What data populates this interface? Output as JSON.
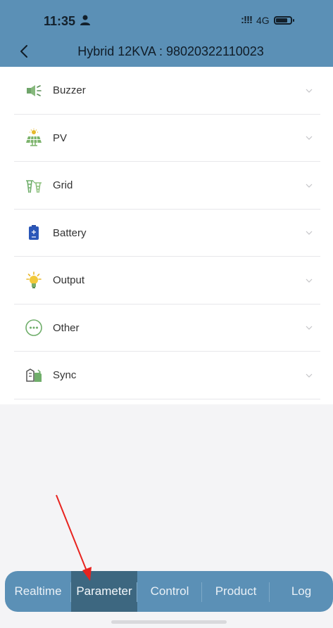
{
  "status_bar": {
    "time": "11:35",
    "signal": ":!!!",
    "network": "4G"
  },
  "header": {
    "title": "Hybrid 12KVA : 98020322110023"
  },
  "menu": {
    "items": [
      {
        "label": "Buzzer",
        "icon": "buzzer-icon"
      },
      {
        "label": "PV",
        "icon": "solar-panel-icon"
      },
      {
        "label": "Grid",
        "icon": "grid-tower-icon"
      },
      {
        "label": "Battery",
        "icon": "battery-icon"
      },
      {
        "label": "Output",
        "icon": "lightbulb-icon"
      },
      {
        "label": "Other",
        "icon": "more-dots-icon"
      },
      {
        "label": "Sync",
        "icon": "sync-icon"
      }
    ]
  },
  "tabbar": {
    "active": "Parameter",
    "tabs": [
      {
        "label": "Realtime"
      },
      {
        "label": "Parameter"
      },
      {
        "label": "Control"
      },
      {
        "label": "Product"
      },
      {
        "label": "Log"
      }
    ]
  },
  "colors": {
    "accent": "#5b90b6",
    "active_tab": "#3d6780",
    "annotation_arrow": "#e8231f"
  }
}
